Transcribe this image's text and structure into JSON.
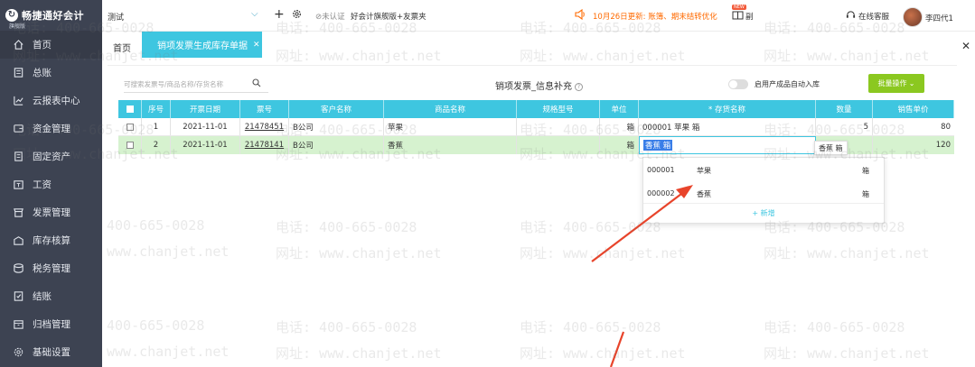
{
  "brand": {
    "name": "畅捷通好会计",
    "edition": "旗舰版"
  },
  "sidebar": {
    "items": [
      {
        "label": "首页",
        "icon": "home-icon"
      },
      {
        "label": "总账",
        "icon": "ledger-icon"
      },
      {
        "label": "云报表中心",
        "icon": "chart-icon"
      },
      {
        "label": "资金管理",
        "icon": "wallet-icon"
      },
      {
        "label": "固定资产",
        "icon": "asset-icon"
      },
      {
        "label": "工资",
        "icon": "payroll-icon"
      },
      {
        "label": "发票管理",
        "icon": "invoice-icon"
      },
      {
        "label": "库存核算",
        "icon": "warehouse-icon"
      },
      {
        "label": "税务管理",
        "icon": "tax-icon"
      },
      {
        "label": "结账",
        "icon": "close-book-icon"
      },
      {
        "label": "归档管理",
        "icon": "archive-icon"
      },
      {
        "label": "基础设置",
        "icon": "settings-icon"
      }
    ]
  },
  "topbar": {
    "company": "测试",
    "cert": "未认证",
    "product": "好会计旗舰版+友票夹",
    "notice": "10月26日更新: 账簿、期末结转优化",
    "gift_badge": "NEW",
    "gift_text": "副",
    "service": "在线客服",
    "user": "李四代1"
  },
  "tabs": {
    "home": "首页",
    "active": "销项发票生成库存单据"
  },
  "toolbar": {
    "search_placeholder": "可搜索发票号/商品名称/存货名称",
    "heading": "销项发票_信息补充",
    "help": "?",
    "toggle_label": "启用产成品自动入库",
    "batch_label": "批量操作"
  },
  "table": {
    "columns": [
      "",
      "序号",
      "开票日期",
      "票号",
      "客户名称",
      "商品名称",
      "规格型号",
      "单位",
      "* 存货名称",
      "数量",
      "销售单价"
    ],
    "rows": [
      {
        "seq": "1",
        "date": "2021-11-01",
        "ticket": "21478451",
        "customer": "B公司",
        "product": "苹果",
        "spec": "",
        "unit": "箱",
        "inventory": "000001 苹果 箱",
        "qty": "5",
        "price": "80"
      },
      {
        "seq": "2",
        "date": "2021-11-01",
        "ticket": "21478141",
        "customer": "B公司",
        "product": "香蕉",
        "spec": "",
        "unit": "箱",
        "inventory": "香蕉 箱",
        "qty": "",
        "price": "120"
      }
    ]
  },
  "tooltip": "香蕉 箱",
  "dropdown": {
    "items": [
      {
        "code": "000001",
        "name": "苹果",
        "unit": "箱"
      },
      {
        "code": "000002",
        "name": "香蕉",
        "unit": "箱"
      }
    ],
    "add_label": "+ 新增"
  },
  "watermark": {
    "phone": "电话: 400-665-0028",
    "site": "网址: www.chanjet.net",
    "phone_short": "400-665-0028",
    "site_short": "www.chanjet.net"
  },
  "colors": {
    "accent": "#3ec6e0",
    "sidebar": "#3d4352",
    "batch": "#8bc820",
    "selected_row": "#d6f2cf",
    "arrow": "#e8442b"
  }
}
